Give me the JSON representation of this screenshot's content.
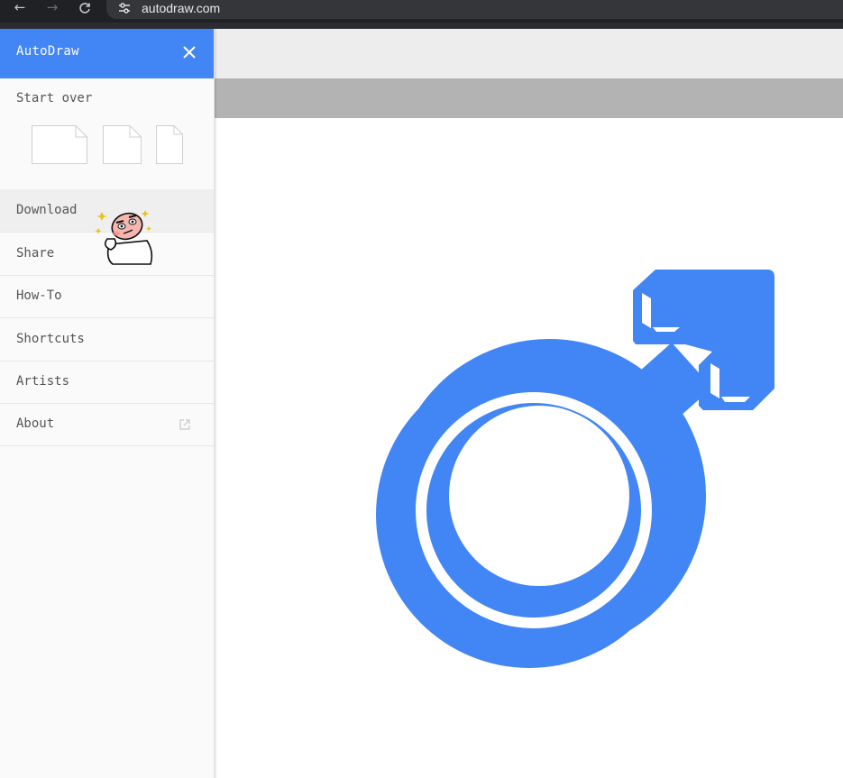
{
  "browser": {
    "url": "autodraw.com",
    "back_icon": "arrow-left-icon",
    "forward_icon": "arrow-right-icon",
    "reload_icon": "reload-icon",
    "site_info_icon": "tune-icon"
  },
  "sidebar": {
    "title": "AutoDraw",
    "close_icon": "close-icon",
    "start_over": "Start over",
    "canvas_options": [
      "landscape-canvas",
      "square-canvas",
      "portrait-canvas"
    ],
    "items": [
      {
        "label": "Download",
        "active": true
      },
      {
        "label": "Share"
      },
      {
        "label": "How-To"
      },
      {
        "label": "Shortcuts"
      },
      {
        "label": "Artists"
      },
      {
        "label": "About",
        "icon": "external-link-icon"
      }
    ]
  },
  "drawing": {
    "symbol": "male-symbol",
    "color": "#4285f4"
  },
  "colors": {
    "accent": "#4285f4",
    "browser_bg": "#202124",
    "toolbar_light": "#ededed",
    "toolbar_dark": "#b3b3b3"
  }
}
